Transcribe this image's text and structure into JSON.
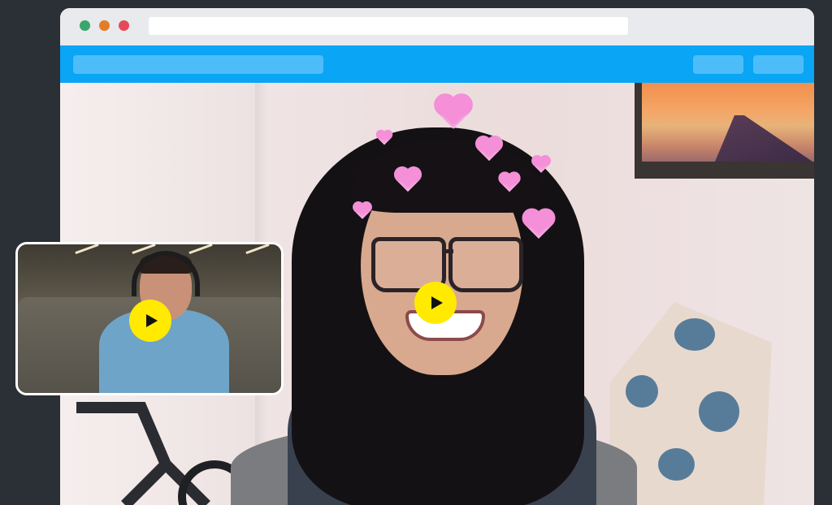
{
  "window": {
    "traffic_lights": [
      {
        "name": "close",
        "color": "#3aa66b"
      },
      {
        "name": "minimize",
        "color": "#e27e27"
      },
      {
        "name": "zoom",
        "color": "#e64a5a"
      }
    ],
    "address_bar_value": ""
  },
  "navbar": {
    "color": "#0aa5f5",
    "search_value": "",
    "buttons": [
      "",
      ""
    ]
  },
  "video_call": {
    "main_video": {
      "filter": "hearts-crown",
      "play_button_icon": "play-icon",
      "play_button_color": "#ffea00"
    },
    "pip_video": {
      "filter": "smile-overlay",
      "play_button_icon": "play-icon",
      "play_button_color": "#ffea00"
    }
  }
}
